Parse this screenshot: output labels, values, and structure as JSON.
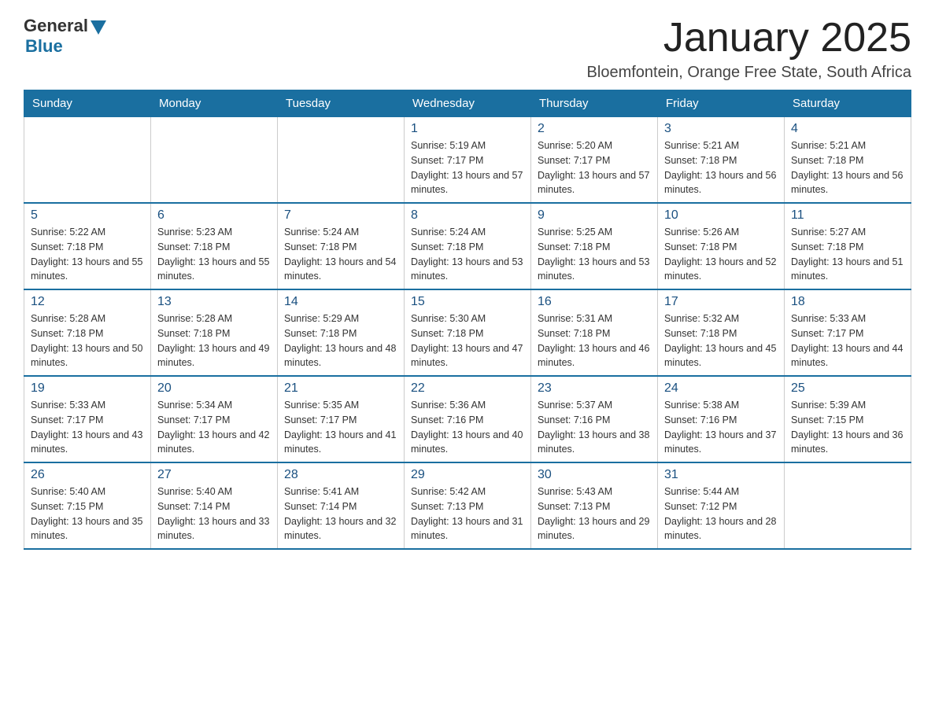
{
  "header": {
    "logo_general": "General",
    "logo_blue": "Blue",
    "month_title": "January 2025",
    "subtitle": "Bloemfontein, Orange Free State, South Africa"
  },
  "days_of_week": [
    "Sunday",
    "Monday",
    "Tuesday",
    "Wednesday",
    "Thursday",
    "Friday",
    "Saturday"
  ],
  "weeks": [
    [
      {
        "day": "",
        "info": ""
      },
      {
        "day": "",
        "info": ""
      },
      {
        "day": "",
        "info": ""
      },
      {
        "day": "1",
        "info": "Sunrise: 5:19 AM\nSunset: 7:17 PM\nDaylight: 13 hours and 57 minutes."
      },
      {
        "day": "2",
        "info": "Sunrise: 5:20 AM\nSunset: 7:17 PM\nDaylight: 13 hours and 57 minutes."
      },
      {
        "day": "3",
        "info": "Sunrise: 5:21 AM\nSunset: 7:18 PM\nDaylight: 13 hours and 56 minutes."
      },
      {
        "day": "4",
        "info": "Sunrise: 5:21 AM\nSunset: 7:18 PM\nDaylight: 13 hours and 56 minutes."
      }
    ],
    [
      {
        "day": "5",
        "info": "Sunrise: 5:22 AM\nSunset: 7:18 PM\nDaylight: 13 hours and 55 minutes."
      },
      {
        "day": "6",
        "info": "Sunrise: 5:23 AM\nSunset: 7:18 PM\nDaylight: 13 hours and 55 minutes."
      },
      {
        "day": "7",
        "info": "Sunrise: 5:24 AM\nSunset: 7:18 PM\nDaylight: 13 hours and 54 minutes."
      },
      {
        "day": "8",
        "info": "Sunrise: 5:24 AM\nSunset: 7:18 PM\nDaylight: 13 hours and 53 minutes."
      },
      {
        "day": "9",
        "info": "Sunrise: 5:25 AM\nSunset: 7:18 PM\nDaylight: 13 hours and 53 minutes."
      },
      {
        "day": "10",
        "info": "Sunrise: 5:26 AM\nSunset: 7:18 PM\nDaylight: 13 hours and 52 minutes."
      },
      {
        "day": "11",
        "info": "Sunrise: 5:27 AM\nSunset: 7:18 PM\nDaylight: 13 hours and 51 minutes."
      }
    ],
    [
      {
        "day": "12",
        "info": "Sunrise: 5:28 AM\nSunset: 7:18 PM\nDaylight: 13 hours and 50 minutes."
      },
      {
        "day": "13",
        "info": "Sunrise: 5:28 AM\nSunset: 7:18 PM\nDaylight: 13 hours and 49 minutes."
      },
      {
        "day": "14",
        "info": "Sunrise: 5:29 AM\nSunset: 7:18 PM\nDaylight: 13 hours and 48 minutes."
      },
      {
        "day": "15",
        "info": "Sunrise: 5:30 AM\nSunset: 7:18 PM\nDaylight: 13 hours and 47 minutes."
      },
      {
        "day": "16",
        "info": "Sunrise: 5:31 AM\nSunset: 7:18 PM\nDaylight: 13 hours and 46 minutes."
      },
      {
        "day": "17",
        "info": "Sunrise: 5:32 AM\nSunset: 7:18 PM\nDaylight: 13 hours and 45 minutes."
      },
      {
        "day": "18",
        "info": "Sunrise: 5:33 AM\nSunset: 7:17 PM\nDaylight: 13 hours and 44 minutes."
      }
    ],
    [
      {
        "day": "19",
        "info": "Sunrise: 5:33 AM\nSunset: 7:17 PM\nDaylight: 13 hours and 43 minutes."
      },
      {
        "day": "20",
        "info": "Sunrise: 5:34 AM\nSunset: 7:17 PM\nDaylight: 13 hours and 42 minutes."
      },
      {
        "day": "21",
        "info": "Sunrise: 5:35 AM\nSunset: 7:17 PM\nDaylight: 13 hours and 41 minutes."
      },
      {
        "day": "22",
        "info": "Sunrise: 5:36 AM\nSunset: 7:16 PM\nDaylight: 13 hours and 40 minutes."
      },
      {
        "day": "23",
        "info": "Sunrise: 5:37 AM\nSunset: 7:16 PM\nDaylight: 13 hours and 38 minutes."
      },
      {
        "day": "24",
        "info": "Sunrise: 5:38 AM\nSunset: 7:16 PM\nDaylight: 13 hours and 37 minutes."
      },
      {
        "day": "25",
        "info": "Sunrise: 5:39 AM\nSunset: 7:15 PM\nDaylight: 13 hours and 36 minutes."
      }
    ],
    [
      {
        "day": "26",
        "info": "Sunrise: 5:40 AM\nSunset: 7:15 PM\nDaylight: 13 hours and 35 minutes."
      },
      {
        "day": "27",
        "info": "Sunrise: 5:40 AM\nSunset: 7:14 PM\nDaylight: 13 hours and 33 minutes."
      },
      {
        "day": "28",
        "info": "Sunrise: 5:41 AM\nSunset: 7:14 PM\nDaylight: 13 hours and 32 minutes."
      },
      {
        "day": "29",
        "info": "Sunrise: 5:42 AM\nSunset: 7:13 PM\nDaylight: 13 hours and 31 minutes."
      },
      {
        "day": "30",
        "info": "Sunrise: 5:43 AM\nSunset: 7:13 PM\nDaylight: 13 hours and 29 minutes."
      },
      {
        "day": "31",
        "info": "Sunrise: 5:44 AM\nSunset: 7:12 PM\nDaylight: 13 hours and 28 minutes."
      },
      {
        "day": "",
        "info": ""
      }
    ]
  ]
}
